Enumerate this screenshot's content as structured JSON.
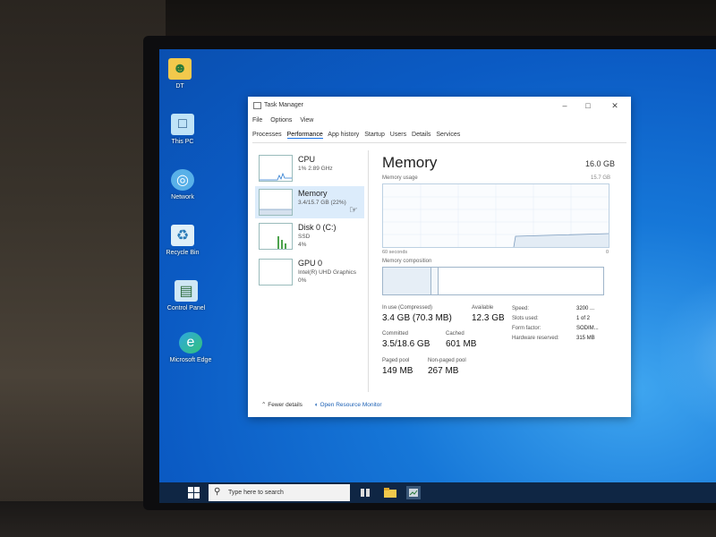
{
  "desktop": {
    "icons": [
      {
        "label": "DT"
      },
      {
        "label": "This PC"
      },
      {
        "label": "Network"
      },
      {
        "label": "Recycle Bin"
      },
      {
        "label": "Control Panel"
      },
      {
        "label": "Microsoft Edge"
      }
    ]
  },
  "task_manager": {
    "title": "Task Manager",
    "menu": [
      "File",
      "Options",
      "View"
    ],
    "tabs": [
      "Processes",
      "Performance",
      "App history",
      "Startup",
      "Users",
      "Details",
      "Services"
    ],
    "active_tab": "Performance",
    "sidebar": [
      {
        "name": "CPU",
        "sub": "1%  2.89 GHz",
        "sub2": ""
      },
      {
        "name": "Memory",
        "sub": "3.4/15.7 GB (22%)",
        "sub2": ""
      },
      {
        "name": "Disk 0 (C:)",
        "sub": "SSD",
        "sub2": "4%"
      },
      {
        "name": "GPU 0",
        "sub": "Intel(R) UHD Graphics",
        "sub2": "0%"
      }
    ],
    "selected_item": "Memory",
    "main": {
      "heading": "Memory",
      "total": "16.0 GB",
      "usage_label": "Memory usage",
      "usage_max": "15.7 GB",
      "seconds_label": "60 seconds",
      "zero_label": "0",
      "composition_label": "Memory composition",
      "stats": {
        "in_use_label": "In use (Compressed)",
        "in_use_value": "3.4 GB (70.3 MB)",
        "available_label": "Available",
        "available_value": "12.3 GB",
        "committed_label": "Committed",
        "committed_value": "3.5/18.6 GB",
        "cached_label": "Cached",
        "cached_value": "601 MB",
        "paged_label": "Paged pool",
        "paged_value": "149 MB",
        "nonpaged_label": "Non-paged pool",
        "nonpaged_value": "267 MB"
      },
      "specs": [
        {
          "k": "Speed:",
          "v": "3200 ..."
        },
        {
          "k": "Slots used:",
          "v": "1 of 2"
        },
        {
          "k": "Form factor:",
          "v": "SODIM..."
        },
        {
          "k": "Hardware reserved:",
          "v": "315 MB"
        }
      ]
    },
    "footer": {
      "fewer_details": "Fewer details",
      "resource_monitor": "Open Resource Monitor"
    }
  },
  "taskbar": {
    "search_placeholder": "Type here to search"
  },
  "colors": {
    "desktop_blue": "#0b5bc4",
    "selection": "#dcecfb",
    "link": "#1a5fb4"
  }
}
